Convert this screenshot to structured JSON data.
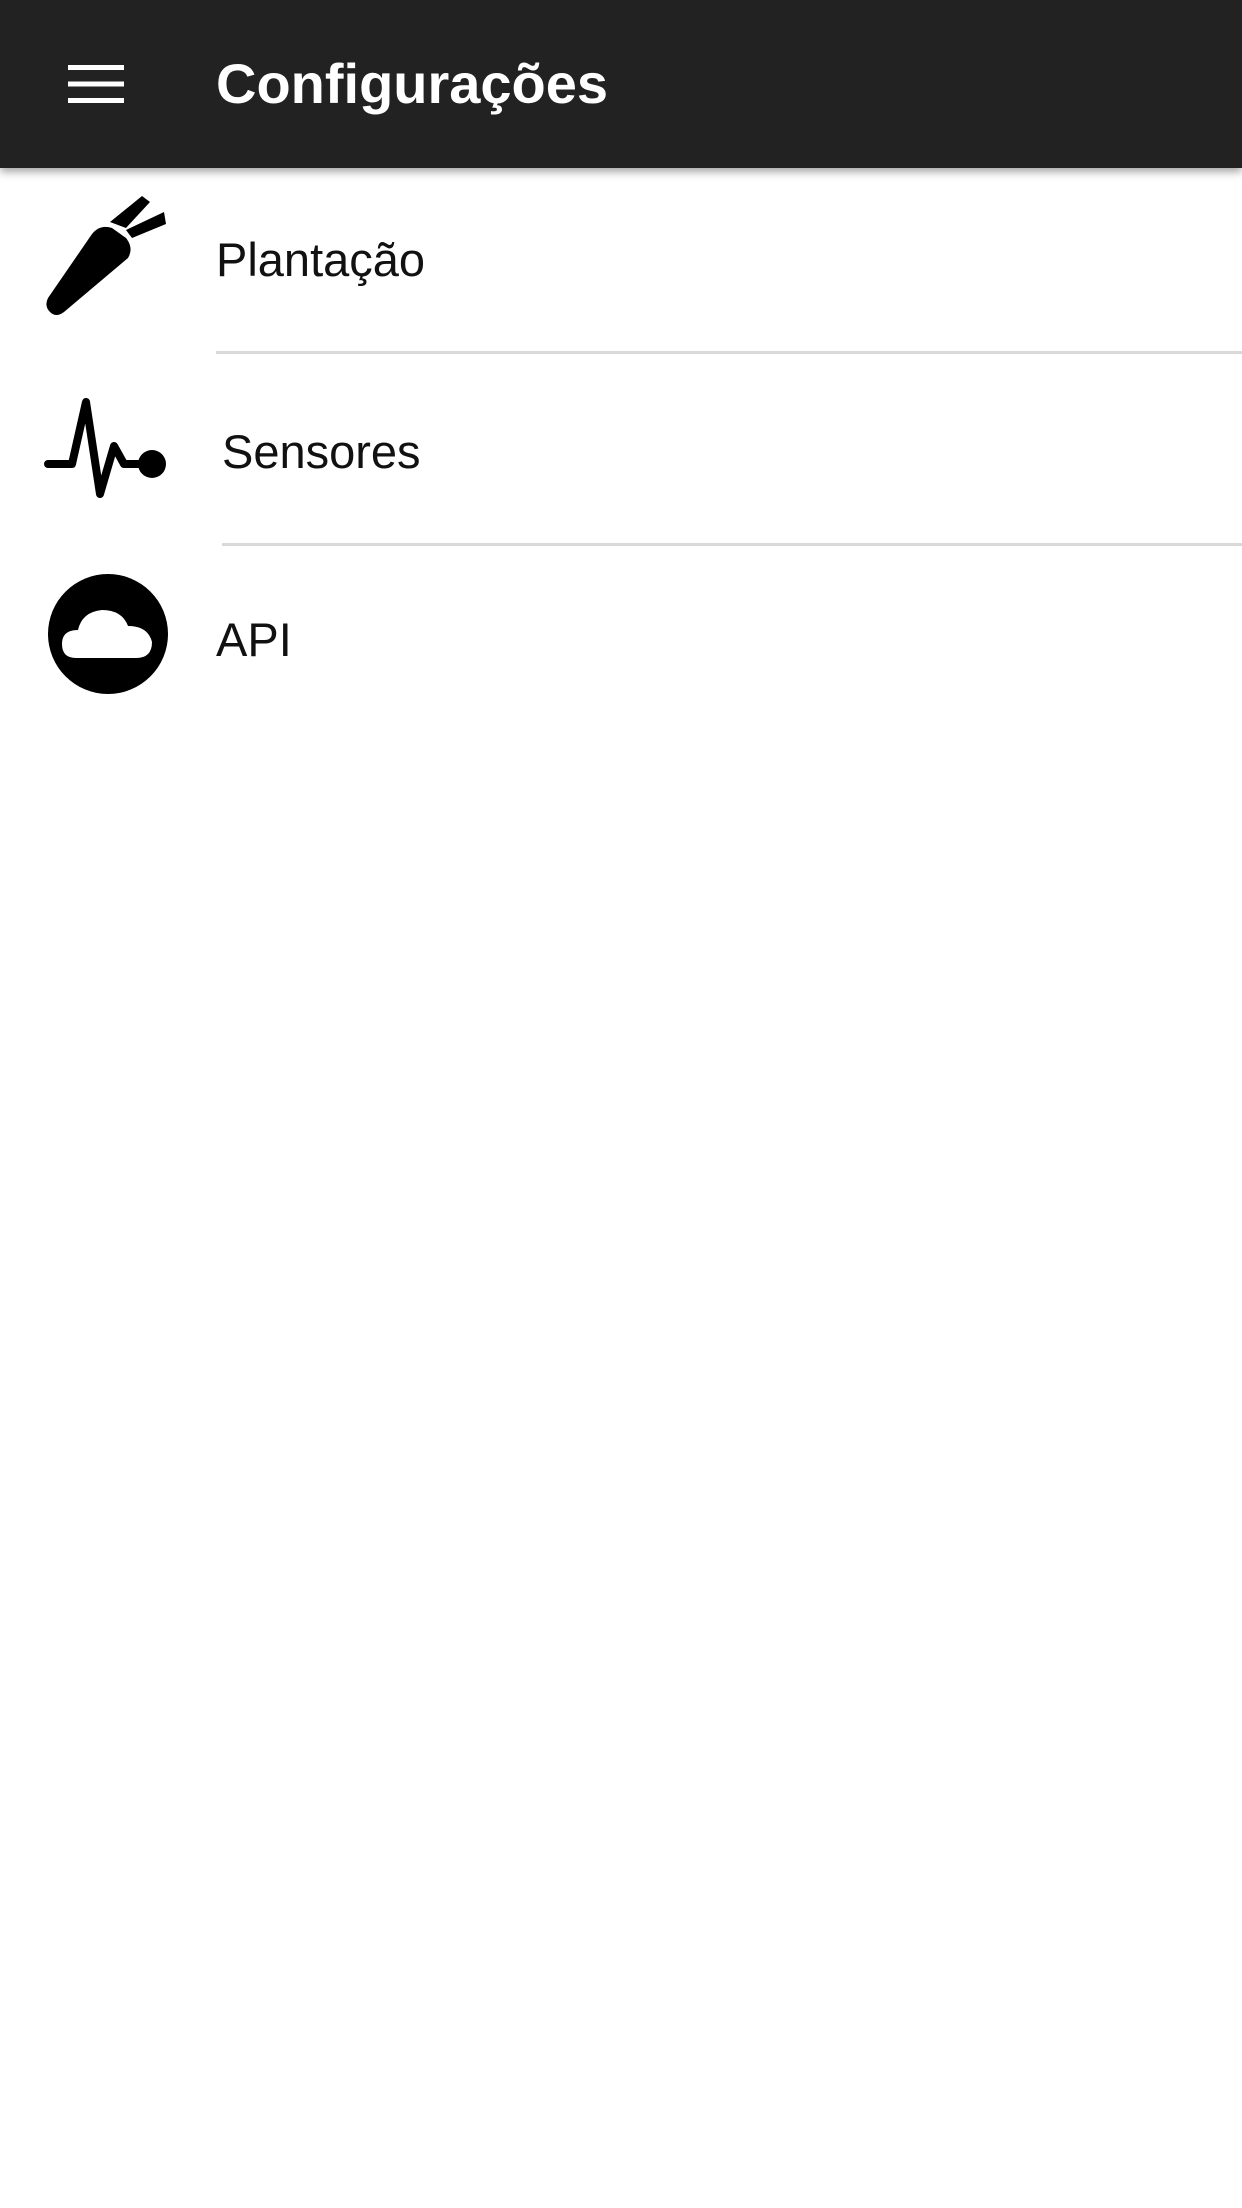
{
  "appbar": {
    "title": "Configurações",
    "menu_icon": "hamburger-menu-icon",
    "background": "#222222",
    "text_color": "#ffffff"
  },
  "settings_list": [
    {
      "label": "Plantação",
      "icon": "carrot-icon"
    },
    {
      "label": "Sensores",
      "icon": "pulse-icon"
    },
    {
      "label": "API",
      "icon": "cloud-circle-icon"
    }
  ],
  "colors": {
    "divider": "#d9d9d9",
    "icon": "#000000",
    "background": "#ffffff"
  }
}
